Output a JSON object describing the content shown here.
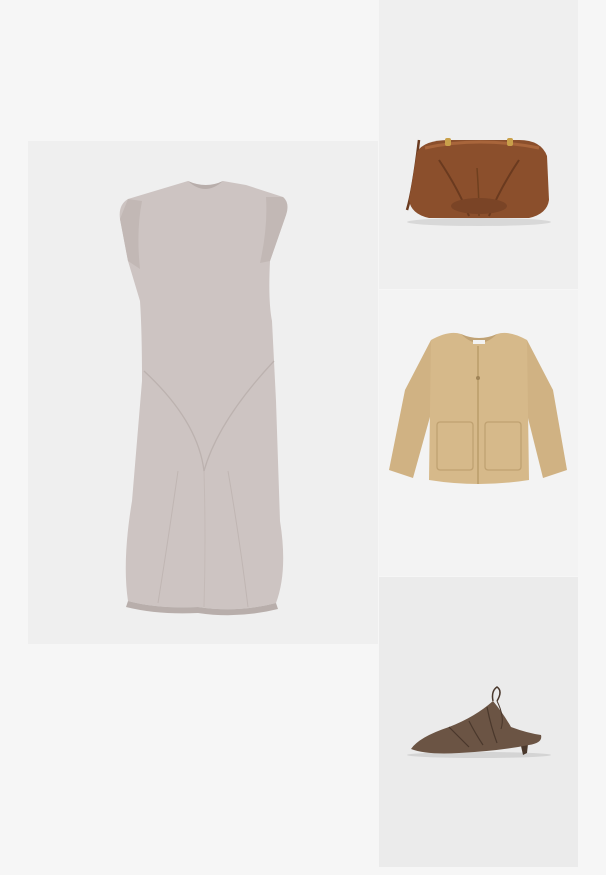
{
  "products": [
    {
      "id": "dress",
      "icon": "dress-icon",
      "colors": {
        "fabric": "#cdc4c2",
        "shadow": "#b8aeab"
      }
    },
    {
      "id": "bag",
      "icon": "clutch-bag-icon",
      "colors": {
        "leather": "#8b4f2c",
        "dark": "#6a3a1f",
        "hardware": "#c9a04a"
      }
    },
    {
      "id": "jacket",
      "icon": "jacket-icon",
      "colors": {
        "wool": "#d6b98a",
        "shadow": "#c0a274"
      }
    },
    {
      "id": "mule",
      "icon": "mule-shoe-icon",
      "colors": {
        "leather": "#6b5444",
        "dark": "#4a382c"
      }
    }
  ]
}
